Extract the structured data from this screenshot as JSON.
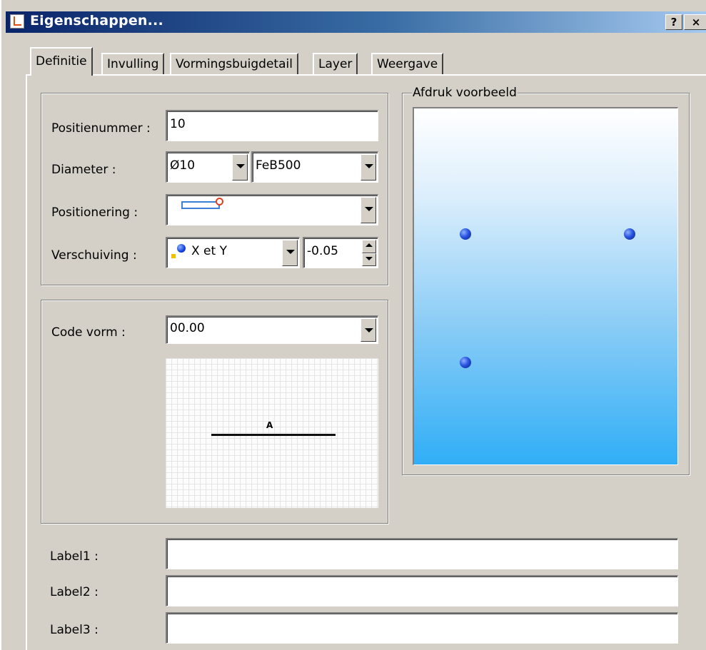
{
  "window": {
    "title": "Eigenschappen..."
  },
  "titlebar_buttons": {
    "help": "?",
    "close": "×"
  },
  "tabs": [
    {
      "label": "Definitie",
      "active": true
    },
    {
      "label": "Invulling",
      "active": false
    },
    {
      "label": "Vormingsbuigdetail",
      "active": false
    },
    {
      "label": "Layer",
      "active": false
    },
    {
      "label": "Weergave",
      "active": false
    }
  ],
  "definitie": {
    "positienummer": {
      "label": "Positienummer :",
      "value": "10"
    },
    "diameter": {
      "label": "Diameter :",
      "size": "Ø10",
      "material": "FeB500"
    },
    "positionering": {
      "label": "Positionering :",
      "icon": "rectangle-bar-icon"
    },
    "verschuiving": {
      "label": "Verschuiving :",
      "mode": "X et Y",
      "value": "-0.05"
    }
  },
  "code_vorm": {
    "label": "Code vorm :",
    "value": "00.00",
    "shape_label": "A"
  },
  "preview": {
    "title": "Afdruk voorbeeld",
    "colors": {
      "top": "#ffffff",
      "bottom": "#30aef6",
      "dot": "#2a55e0"
    }
  },
  "labels": [
    {
      "label": "Label1 :",
      "value": ""
    },
    {
      "label": "Label2 :",
      "value": ""
    },
    {
      "label": "Label3 :",
      "value": ""
    }
  ]
}
